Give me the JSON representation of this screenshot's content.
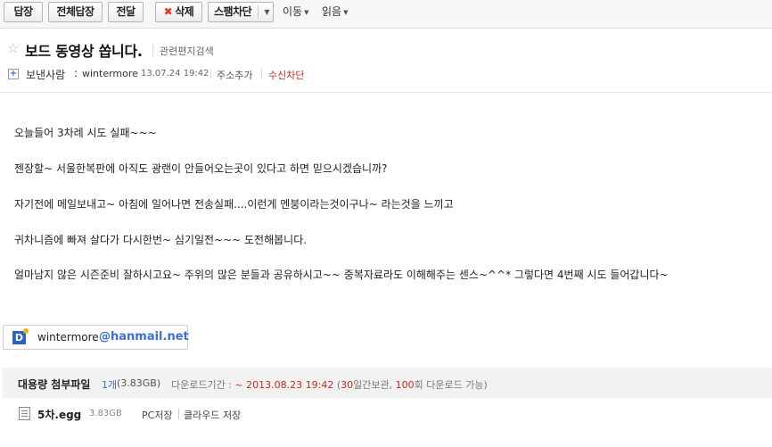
{
  "toolbar": {
    "reply": "답장",
    "reply_all": "전체답장",
    "forward": "전달",
    "delete": "삭제",
    "spam_block": "스팸차단",
    "move": "이동",
    "read": "읽음"
  },
  "header": {
    "subject": "보드 동영상 쏩니다.",
    "related_search": "관련편지검색",
    "sender_label": "보낸사람",
    "sender_name": "wintermore",
    "date": "13.07.24 19:42",
    "add_address": "주소추가",
    "block_receive": "수신차단"
  },
  "body": {
    "lines": [
      " 오늘들어 3차례 시도 실패~~~",
      "젠장할~ 서울한복판에 아직도 광랜이 안들어오는곳이 있다고 하면 믿으시겠습니까?",
      "자기전에 메일보내고~ 아침에 일어나면 전송실패....이런게 멘붕이라는것이구나~ 라는것을 느끼고",
      "귀차니즘에 빠져 살다가 다시한번~ 심기일전~~~ 도전해봅니다.",
      "얼마남지 않은 시즌준비 잘하시고요~ 주위의 많은 분들과 공유하시고~~ 중복자료라도 이해해주는 센스~^^* 그렇다면 4번째 시도 들어갑니다~"
    ]
  },
  "signature": {
    "user": "wintermore",
    "domain": "@hanmail.net"
  },
  "attachment": {
    "title": "대용량 첨부파일",
    "count": "1개",
    "total_size": "(3.83GB)",
    "download_label": "다운로드기간 : ",
    "download_until": "~ 2013.08.23 19:42",
    "retention_open": " (",
    "retention_days": "30",
    "retention_mid": "일간보관, ",
    "download_count": "100",
    "retention_close": "회 다운로드 가능)",
    "file_name": "5차.egg",
    "file_size": "3.83GB",
    "pc_save": "PC저장",
    "cloud_save": "클라우드 저장"
  },
  "colors": {
    "accent_red": "#c8291f",
    "link_blue": "#3a6dc5",
    "daum_blue": "#3b6fd8"
  }
}
